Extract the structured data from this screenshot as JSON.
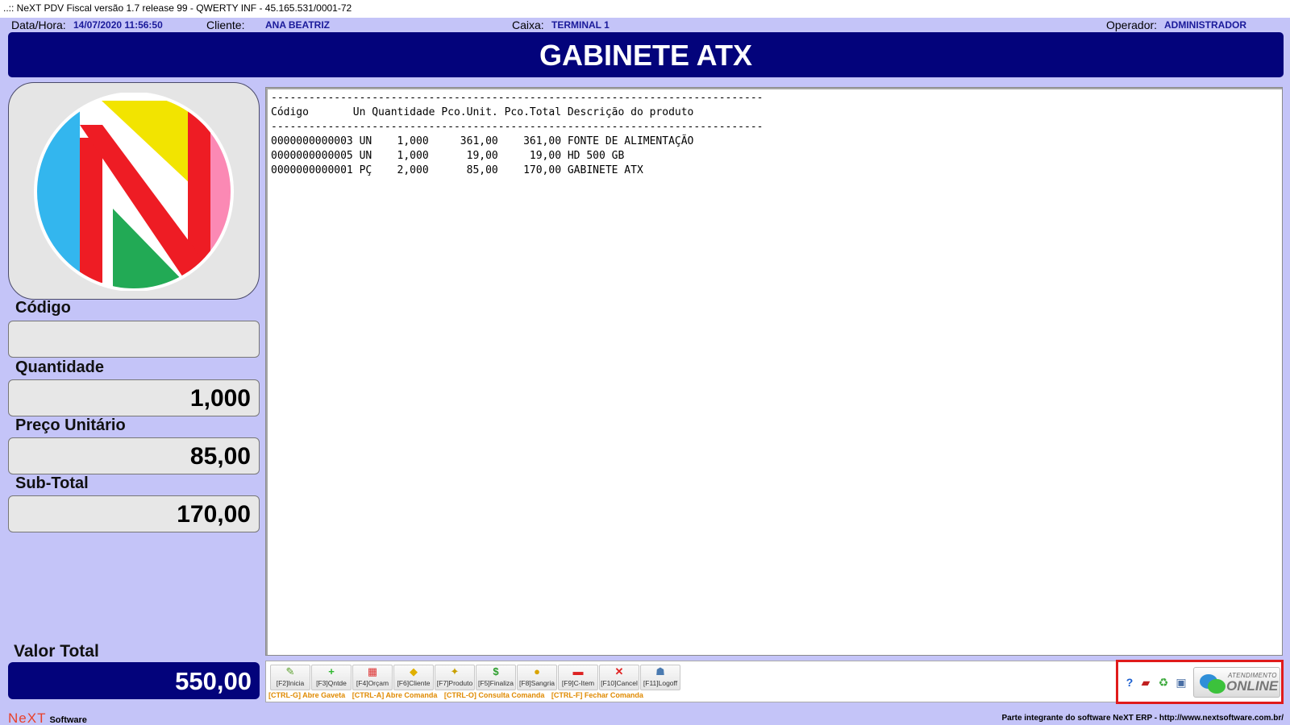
{
  "window": {
    "title": "..:: NeXT PDV Fiscal versão 1.7 release 99 - QWERTY INF - 45.165.531/0001-72"
  },
  "header": {
    "datetime_label": "Data/Hora:",
    "datetime_value": "14/07/2020 11:56:50",
    "client_label": "Cliente:",
    "client_value": "ANA BEATRIZ",
    "register_label": "Caixa:",
    "register_value": "TERMINAL 1",
    "operator_label": "Operador:",
    "operator_value": "ADMINISTRADOR"
  },
  "banner": {
    "product": "GABINETE ATX"
  },
  "fields": {
    "code_label": "Código",
    "code_value": "",
    "qty_label": "Quantidade",
    "qty_value": "1,000",
    "unit_price_label": "Preço Unitário",
    "unit_price_value": "85,00",
    "subtotal_label": "Sub-Total",
    "subtotal_value": "170,00",
    "total_label": "Valor Total",
    "total_value": "550,00"
  },
  "listing": {
    "separator": "------------------------------------------------------------------------------",
    "header": "Código       Un Quantidade Pco.Unit. Pco.Total Descrição do produto",
    "rows": [
      "0000000000003 UN    1,000     361,00    361,00 FONTE DE ALIMENTAÇÃO",
      "0000000000005 UN    1,000      19,00     19,00 HD 500 GB",
      "0000000000001 PÇ    2,000      85,00    170,00 GABINETE ATX"
    ]
  },
  "toolbar": {
    "buttons": [
      {
        "label": "[F2]Inicia",
        "icon": "pencil-icon"
      },
      {
        "label": "[F3]Qntde",
        "icon": "plus-icon"
      },
      {
        "label": "[F4]Orçam",
        "icon": "calendar-icon"
      },
      {
        "label": "[F6]Cliente",
        "icon": "tag-icon"
      },
      {
        "label": "[F7]Produto",
        "icon": "product-icon"
      },
      {
        "label": "[F5]Finaliza",
        "icon": "dollar-icon"
      },
      {
        "label": "[F8]Sangria",
        "icon": "coins-icon"
      },
      {
        "label": "[F9]C-Item",
        "icon": "remove-item-icon"
      },
      {
        "label": "[F10]Cancel",
        "icon": "cancel-icon"
      },
      {
        "label": "[F11]Logoff",
        "icon": "logoff-icon"
      }
    ],
    "shortcuts": [
      "[CTRL-G] Abre Gaveta",
      "[CTRL-A] Abre Comanda",
      "[CTRL-O] Consulta Comanda",
      "[CTRL-F] Fechar Comanda"
    ]
  },
  "online": {
    "small": "ATENDIMENTO",
    "big": "ONLINE",
    "icons": [
      "help-icon",
      "car-icon",
      "recycle-icon",
      "monitor-icon"
    ]
  },
  "footer": {
    "brand_next": "NeXT",
    "brand_software": "Software",
    "note": "Parte integrante do software NeXT ERP - http://www.nextsoftware.com.br/"
  },
  "colors": {
    "background": "#c4c4f8",
    "banner": "#03037b",
    "accent_text": "#1a1a9a",
    "shortcut_text": "#e08a00",
    "highlight_border": "#e01b1b"
  }
}
